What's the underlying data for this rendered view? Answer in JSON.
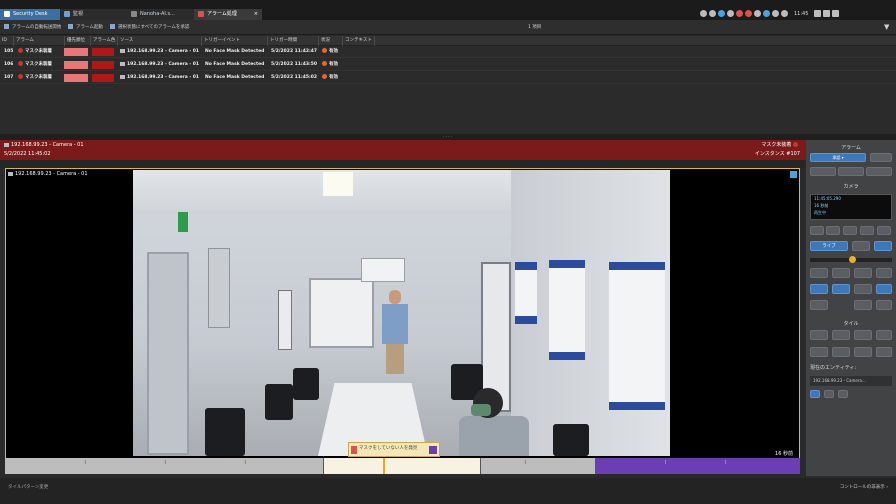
{
  "tabs": [
    {
      "label": "Security Desk"
    },
    {
      "label": "監視"
    },
    {
      "label": "Nanoha-AI.s..."
    },
    {
      "label": "アラーム処理"
    }
  ],
  "tray": {
    "clock": "11:45"
  },
  "toolbar": {
    "items": [
      "アラームの自動転送開始",
      "アラーム起動",
      "選択状態にすべてのアラームを承認"
    ],
    "count": "1 項目"
  },
  "table": {
    "headers": [
      "ID",
      "アラーム",
      "優先順位",
      "アラーム色",
      "ソース",
      "トリガーイベント",
      "トリガー時間",
      "状況",
      "コンテキスト"
    ],
    "rows": [
      {
        "id": "105",
        "alarm": "マスク未装着",
        "source": "192.168.99.23 - Camera - 01",
        "event": "No Face Mask Detected",
        "time": "5/2/2022 11:42:47",
        "status": "有効"
      },
      {
        "id": "106",
        "alarm": "マスク未装着",
        "source": "192.168.99.23 - Camera - 01",
        "event": "No Face Mask Detected",
        "time": "5/2/2022 11:43:50",
        "status": "有効"
      },
      {
        "id": "107",
        "alarm": "マスク未装着",
        "source": "192.168.99.23 - Camera - 01",
        "event": "No Face Mask Detected",
        "time": "5/2/2022 11:45:02",
        "status": "有効"
      }
    ]
  },
  "alarm_header": {
    "source": "192.168.99.23 - Camera - 01",
    "time": "5/2/2022 11:45:02",
    "alarm": "マスク未装着",
    "instance_label": "インスタンス",
    "instance": "#107"
  },
  "video": {
    "title": "192.168.99.23 - Camera - 01",
    "timestamp": "16 秒前",
    "toast": "マスクをしていない人を発見"
  },
  "right_panel": {
    "alarm_title": "アラーム",
    "alarm_dropdown": "承認",
    "camera_title": "カメラ",
    "cam_time": "11:45:05.290",
    "cam_ago": "16 秒前",
    "cam_mode": "再生中",
    "live_label": "ライブ",
    "tile_title": "タイル",
    "entity_title": "現在のエンティティ:",
    "entity": "192.168.99.23 - Camera..."
  },
  "status": {
    "left": "タイルパターン変更",
    "right": "コントロールの非表示"
  },
  "colors": {
    "accent": "#3a6fa3",
    "alarm_bar": "#7a1a1a",
    "priority": "#e87878",
    "alarm_color": "#b01818",
    "timeline_purple": "#6b3fb3"
  }
}
